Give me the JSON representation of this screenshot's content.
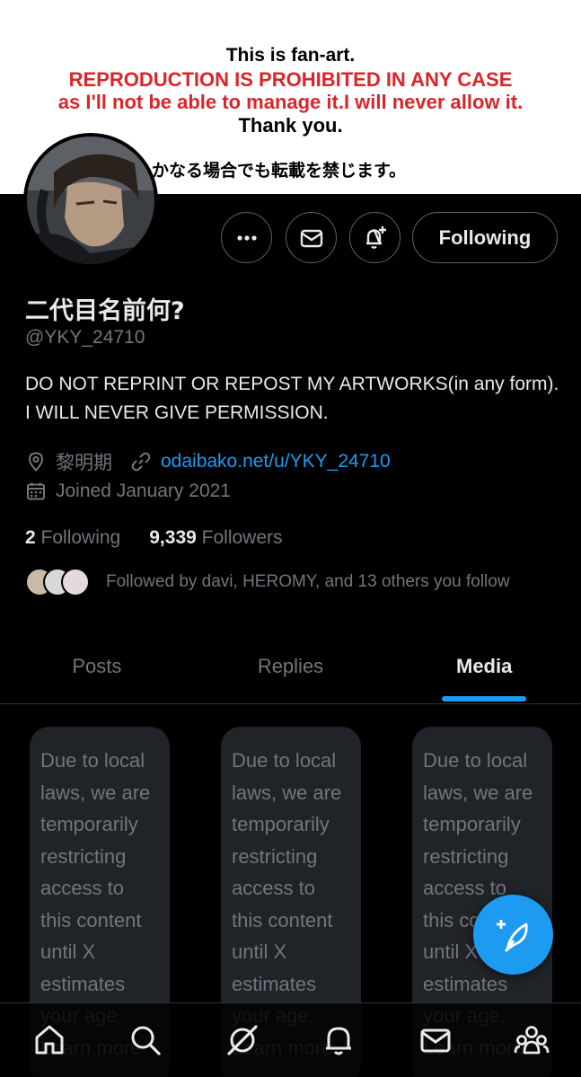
{
  "banner": {
    "line1": "This is fan-art.",
    "line2": "REPRODUCTION IS PROHIBITED IN ANY CASE",
    "line3": "as I'll not be able to manage it.I will never allow it.",
    "line4": "Thank you.",
    "line5": "いかなる場合でも転載を禁じます。"
  },
  "actions": {
    "more_icon": "more-dots-icon",
    "message_icon": "mail-icon",
    "notify_icon": "bell-plus-icon",
    "follow_label": "Following"
  },
  "profile": {
    "name": "二代目名前何?",
    "handle": "@YKY_24710",
    "bio": "DO NOT REPRINT OR REPOST MY ARTWORKS(in any form). I WILL NEVER GIVE PERMISSION.",
    "location": "黎明期",
    "link": "odaibako.net/u/YKY_24710",
    "joined": "Joined January 2021"
  },
  "stats": {
    "following_count": "2",
    "following_label": "Following",
    "followers_count": "9,339",
    "followers_label": "Followers"
  },
  "followed_by": "Followed by davi, HEROMY, and 13 others you follow",
  "tabs": [
    {
      "label": "Posts",
      "active": false
    },
    {
      "label": "Replies",
      "active": false
    },
    {
      "label": "Media",
      "active": true
    }
  ],
  "media_notice": "Due to local laws, we are temporarily restricting access to this content until X estimates your age. Learn more",
  "bottom_nav": [
    "home-icon",
    "search-icon",
    "grok-icon",
    "notifications-icon",
    "messages-icon",
    "communities-icon"
  ],
  "colors": {
    "accent": "#1d9bf0",
    "background": "#000000",
    "muted_text": "#71767b",
    "banner_red": "#d9262b"
  }
}
